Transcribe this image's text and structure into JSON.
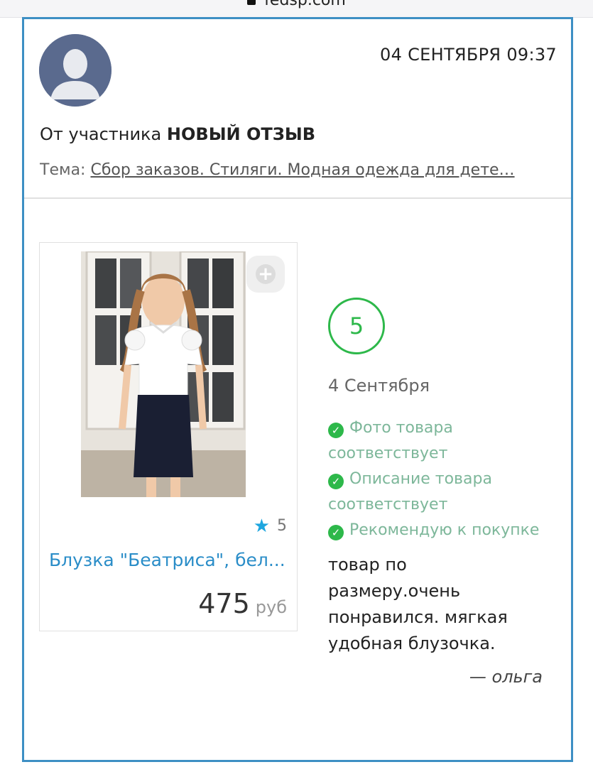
{
  "browser": {
    "url": "fedsp.com"
  },
  "header": {
    "datetime": "04 СЕНТЯБРЯ 09:37",
    "from_prefix": "От участника",
    "from_title": "НОВЫЙ ОТЗЫВ",
    "topic_label": "Тема:",
    "topic_link": "Сбор заказов. Стиляги. Модная одежда для дете…"
  },
  "product": {
    "rating": "5",
    "name": "Блузка \"Беатриса\", бел...",
    "price": "475",
    "currency": "руб"
  },
  "review": {
    "score": "5",
    "date": "4 Сентября",
    "checks": [
      {
        "label": "Фото товара соответствует"
      },
      {
        "label": "Описание товара соответствует"
      },
      {
        "label": "Рекомендую к покупке"
      }
    ],
    "text": "товар по размеру.очень понравился. мягкая удобная блузочка.",
    "author": "— ольга"
  },
  "colors": {
    "border": "#3d8fc4",
    "link": "#2a8dc8",
    "green": "#2db84a",
    "star": "#1ea6df"
  }
}
